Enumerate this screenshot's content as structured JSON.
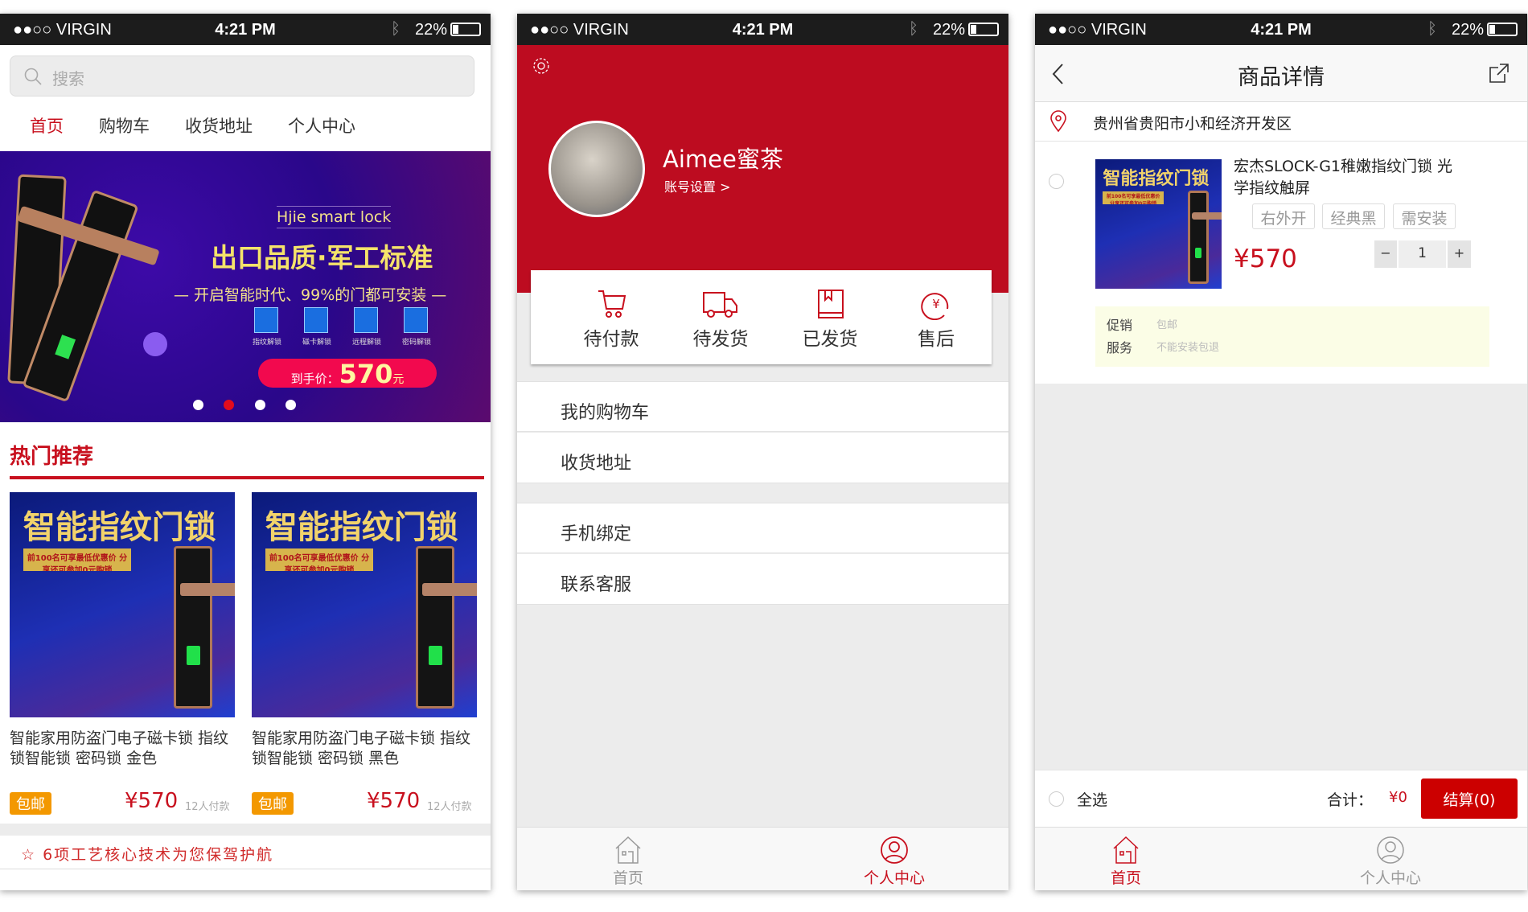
{
  "status_bar": {
    "carrier": "●●○○ VIRGIN",
    "time": "4:21 PM",
    "battery": "22%",
    "battery_level": 0.22
  },
  "home": {
    "search_placeholder": "搜索",
    "nav": [
      "首页",
      "购物车",
      "收货地址",
      "个人中心"
    ],
    "banner": {
      "brand": "Hjie smart lock",
      "headline": "出口品质·军工标准",
      "subline": "— 开启智能时代、99%的门都可安装 —",
      "features": [
        "指纹解锁",
        "磁卡解锁",
        "远程解锁",
        "密码解锁"
      ],
      "price_label": "到手价：",
      "price": "570",
      "price_unit": "元",
      "active_dot": 1,
      "dots": 4
    },
    "section_title": "热门推荐",
    "products": [
      {
        "image_title": "智能指纹门锁",
        "image_promo": "前100名可享最低优惠价 分享还可参加0元购锁",
        "title": "智能家用防盗门电子磁卡锁 指纹锁智能锁 密码锁 金色",
        "badge": "包邮",
        "price": "¥570",
        "sales": "12人付款"
      },
      {
        "image_title": "智能指纹门锁",
        "image_promo": "前100名可享最低优惠价 分享还可参加0元购锁",
        "title": "智能家用防盗门电子磁卡锁 指纹锁智能锁 密码锁 黑色",
        "badge": "包邮",
        "price": "¥570",
        "sales": "12人付款"
      }
    ],
    "footer_note": "6项工艺核心技术为您保驾护航"
  },
  "profile": {
    "username": "Aimee蜜茶",
    "account_settings": "账号设置 >",
    "orders": [
      "待付款",
      "待发货",
      "已发货",
      "售后"
    ],
    "menu_group1": [
      "我的购物车",
      "收货地址"
    ],
    "menu_group2": [
      "手机绑定",
      "联系客服"
    ]
  },
  "detail": {
    "title": "商品详情",
    "address": "贵州省贵阳市小和经济开发区",
    "product": {
      "image_title": "智能指纹门锁",
      "image_promo": "前100名可享最低优惠价 分享还可参加0元购锁",
      "title": "宏杰SLOCK-G1稚嫩指纹门锁 光学指纹触屏",
      "tags": [
        "右外开",
        "经典黑",
        "需安装"
      ],
      "price": "¥570",
      "quantity": "1",
      "minus": "−",
      "plus": "+"
    },
    "promo": {
      "label1": "促销",
      "value1": "包邮",
      "label2": "服务",
      "value2": "不能安装包退"
    },
    "select_all": "全选",
    "total_label": "合计：",
    "total": "¥0",
    "checkout": "结算(0)"
  },
  "tabbar": {
    "home": "首页",
    "me": "个人中心"
  },
  "colors": {
    "accent": "#c8101e",
    "badge": "#f39800",
    "banner": "#3a0a9a"
  }
}
